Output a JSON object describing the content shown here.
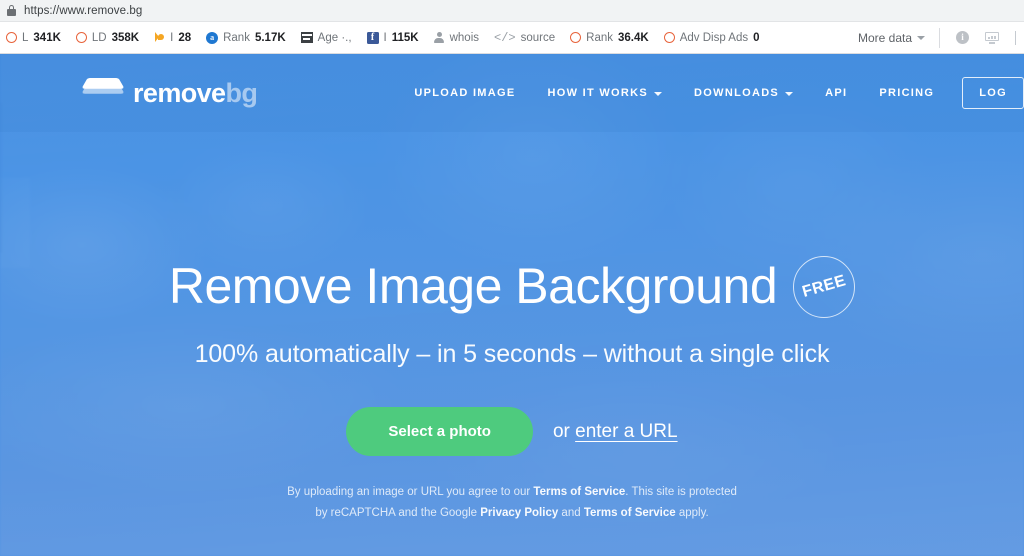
{
  "browser": {
    "url": "https://www.remove.bg",
    "lock_icon": "lock-icon"
  },
  "seo_toolbar": {
    "items": [
      {
        "icon": "moz-ring-icon",
        "label": "L",
        "value": "341K"
      },
      {
        "icon": "moz-ring-icon",
        "label": "LD",
        "value": "358K"
      },
      {
        "icon": "bing-icon",
        "label": "I",
        "value": "28"
      },
      {
        "icon": "alexa-icon",
        "label": "Rank",
        "value": "5.17K"
      },
      {
        "icon": "archive-icon",
        "label": "Age ·.,",
        "value": ""
      },
      {
        "icon": "facebook-icon",
        "label": "I",
        "value": "115K"
      },
      {
        "icon": "person-icon",
        "label": "whois",
        "value": ""
      },
      {
        "icon": "code-icon",
        "label": "source",
        "value": ""
      },
      {
        "icon": "moz-ring-icon",
        "label": "Rank",
        "value": "36.4K"
      },
      {
        "icon": "moz-ring-icon",
        "label": "Adv Disp Ads",
        "value": "0"
      }
    ],
    "more_data_label": "More data",
    "right_icons": [
      "info-icon",
      "monitor-chart-icon"
    ]
  },
  "site": {
    "logo": {
      "mark": "layers-icon",
      "word1": "remove",
      "word2": "bg"
    },
    "nav": [
      {
        "label": "UPLOAD IMAGE",
        "caret": false
      },
      {
        "label": "HOW IT WORKS",
        "caret": true
      },
      {
        "label": "DOWNLOADS",
        "caret": true
      },
      {
        "label": "API",
        "caret": false
      },
      {
        "label": "PRICING",
        "caret": false
      }
    ],
    "login_label": "LOG"
  },
  "hero": {
    "headline": "Remove Image Background",
    "badge": "FREE",
    "subhead": "100% automatically – in 5 seconds – without a single click",
    "cta_button": "Select a photo",
    "or_prefix": "or ",
    "url_link": "enter a URL",
    "fineprint": {
      "line1_a": "By uploading an image or URL you agree to our ",
      "line1_link": "Terms of Service",
      "line1_b": ". This site is protected",
      "line2_a": "by reCAPTCHA and the Google ",
      "line2_link1": "Privacy Policy",
      "line2_b": " and ",
      "line2_link2": "Terms of Service",
      "line2_c": " apply."
    }
  },
  "colors": {
    "hero_blue": "#4a90e2",
    "cta_green": "#4ecb7e",
    "moz_orange": "#e8643c",
    "facebook_blue": "#3b5998",
    "alexa_blue": "#1f78d1"
  }
}
